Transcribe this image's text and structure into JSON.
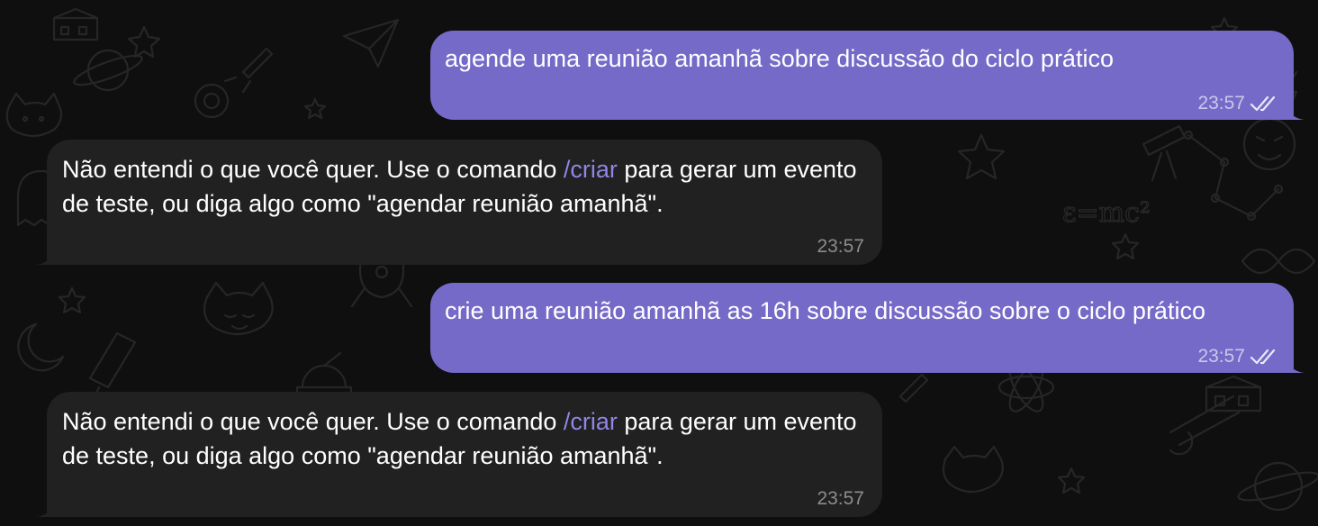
{
  "messages": [
    {
      "direction": "outgoing",
      "text": "agende uma reunião amanhã sobre discussão do ciclo prático",
      "time": "23:57",
      "status": "read"
    },
    {
      "direction": "incoming",
      "text_before": "Não entendi o que você quer. Use o comando ",
      "command": "/criar",
      "text_after": " para gerar um evento de teste, ou diga algo como \"agendar reunião amanhã\".",
      "time": "23:57"
    },
    {
      "direction": "outgoing",
      "text": "crie uma reunião amanhã as 16h sobre discussão sobre o ciclo prático",
      "time": "23:57",
      "status": "read"
    },
    {
      "direction": "incoming",
      "text_before": "Não entendi o que você quer. Use o comando ",
      "command": "/criar",
      "text_after": " para gerar um evento de teste, ou diga algo como \"agendar reunião amanhã\".",
      "time": "23:57"
    }
  ],
  "colors": {
    "outgoing_bubble": "#766ac8",
    "incoming_bubble": "#212121",
    "command_link": "#8f86e6",
    "background": "#0f0f0f"
  },
  "icons": {
    "status": "double-check-icon"
  }
}
